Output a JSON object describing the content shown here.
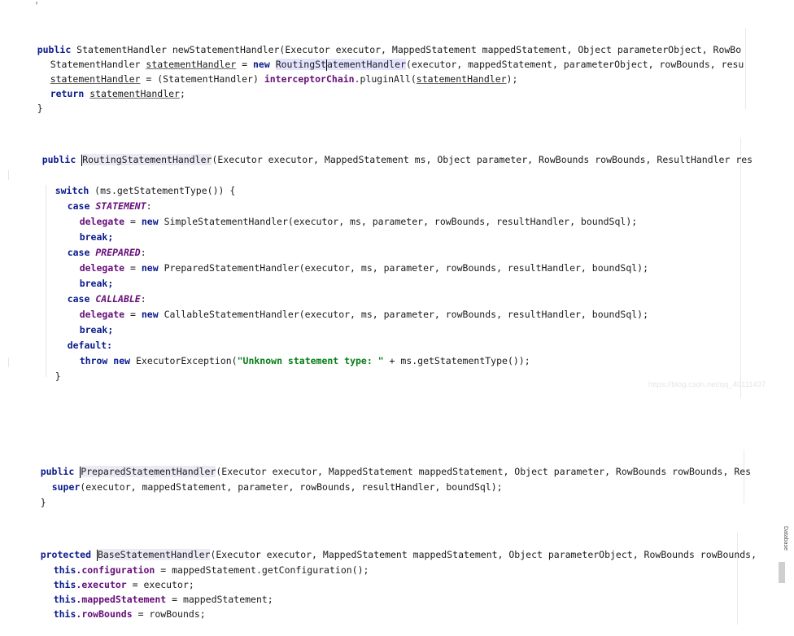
{
  "top_fragment": "' ',",
  "block1": {
    "line1": {
      "kw": "public",
      "rest_a": " StatementHandler newStatementHandler(Executor executor, MappedStatement mappedStatement, Object parameterObject, RowBo"
    },
    "line2": {
      "pre": "StatementHandler ",
      "var": "statementHandler",
      "eq": " = ",
      "kw": "new",
      "sp": " ",
      "cls_a": "RoutingSt",
      "cls_b": "atementHandler",
      "rest": "(executor, mappedStatement, parameterObject, rowBounds, resu"
    },
    "line3": {
      "var": "statementHandler",
      "mid": " = (StatementHandler) ",
      "fld": "interceptorChain",
      "call": ".pluginAll(",
      "arg": "statementHandler",
      "end": ");"
    },
    "line4": {
      "kw": "return",
      "sp": " ",
      "var": "statementHandler",
      "end": ";"
    },
    "line5": "}"
  },
  "block2": {
    "line1": {
      "kw": "public",
      "sp": " ",
      "cls": "RoutingStatementHandler",
      "rest": "(Executor executor, MappedStatement ms, Object parameter, RowBounds rowBounds, ResultHandler res"
    },
    "switch": {
      "kw": "switch",
      "rest": " (ms.getStatementType()) {"
    },
    "case1": {
      "kw": "case",
      "const": "STATEMENT",
      "colon": ":"
    },
    "deleg1": {
      "fld": "delegate",
      "eq": " = ",
      "kw": "new",
      "rest": " SimpleStatementHandler(executor, ms, parameter, rowBounds, resultHandler, boundSql);"
    },
    "brk1": "break;",
    "case2": {
      "kw": "case",
      "const": "PREPARED",
      "colon": ":"
    },
    "deleg2": {
      "fld": "delegate",
      "eq": " = ",
      "kw": "new",
      "rest": " PreparedStatementHandler(executor, ms, parameter, rowBounds, resultHandler, boundSql);"
    },
    "brk2": "break;",
    "case3": {
      "kw": "case",
      "const": "CALLABLE",
      "colon": ":"
    },
    "deleg3": {
      "fld": "delegate",
      "eq": " = ",
      "kw": "new",
      "rest": " CallableStatementHandler(executor, ms, parameter, rowBounds, resultHandler, boundSql);"
    },
    "brk3": "break;",
    "default": "default:",
    "throw": {
      "kw1": "throw",
      "kw2": "new",
      "mid": " ExecutorException(",
      "str": "\"Unknown statement type: \"",
      "end": " + ms.getStatementType());"
    },
    "close1": "}",
    "close2": "}",
    "watermark": "https://blog.csdn.net/qq_40111437"
  },
  "block3": {
    "line1": {
      "kw": "public",
      "sp": " ",
      "cls": "PreparedStatementHandler",
      "rest": "(Executor executor, MappedStatement mappedStatement, Object parameter, RowBounds rowBounds, Res"
    },
    "line2": {
      "kw": "super",
      "rest": "(executor, mappedStatement, parameter, rowBounds, resultHandler, boundSql);"
    },
    "line3": "}"
  },
  "block4": {
    "line1": {
      "kw": "protected",
      "sp": " ",
      "cls": "BaseStatementHandler",
      "rest": "(Executor executor, MappedStatement mappedStatement, Object parameterObject, RowBounds rowBounds,"
    },
    "line2": {
      "kw": "this",
      "fld": ".configuration",
      "rest": " = mappedStatement.getConfiguration();"
    },
    "line3": {
      "kw": "this",
      "fld": ".executor",
      "rest": " = executor;"
    },
    "line4": {
      "kw": "this",
      "fld": ".mappedStatement",
      "rest": " = mappedStatement;"
    },
    "line5": {
      "kw": "this",
      "fld": ".rowBounds",
      "rest": " = rowBounds;"
    },
    "side_tab": "Database"
  }
}
